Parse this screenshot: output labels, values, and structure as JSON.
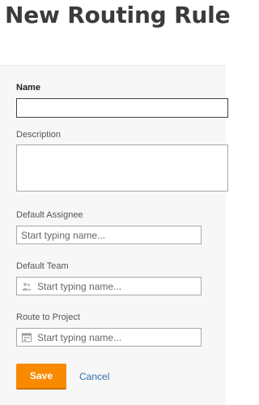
{
  "page": {
    "title": "New Routing Rule"
  },
  "form": {
    "name": {
      "label": "Name",
      "value": ""
    },
    "description": {
      "label": "Description",
      "value": ""
    },
    "default_assignee": {
      "label": "Default Assignee",
      "placeholder": "Start typing name..."
    },
    "default_team": {
      "label": "Default Team",
      "placeholder": "Start typing name...",
      "icon": "team-icon"
    },
    "route_to_project": {
      "label": "Route to Project",
      "placeholder": "Start typing name...",
      "icon": "project-icon"
    }
  },
  "actions": {
    "save_label": "Save",
    "cancel_label": "Cancel"
  },
  "colors": {
    "accent": "#f98a00",
    "link": "#2f6ea8"
  }
}
